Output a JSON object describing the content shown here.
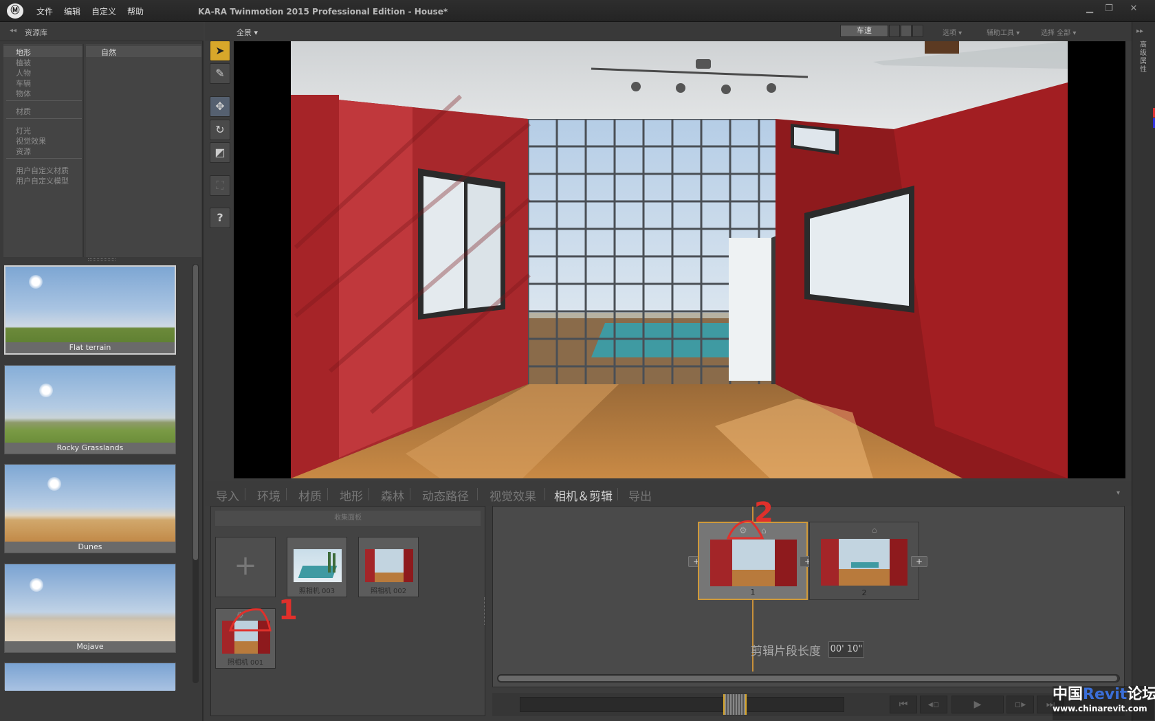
{
  "app": {
    "title": "KA-RA Twinmotion 2015 Professional Edition - House*",
    "logo": "Ⓜ",
    "menu": [
      "文件",
      "编辑",
      "自定义",
      "帮助"
    ]
  },
  "library": {
    "header": "资源库",
    "categories": [
      "地形",
      "植被",
      "人物",
      "车辆",
      "物体",
      "材质",
      "灯光",
      "视觉效果",
      "资源",
      "用户自定义材质",
      "用户自定义模型"
    ],
    "selected_category": "地形",
    "subcategory": "自然",
    "thumbnails": [
      {
        "label": "Flat terrain"
      },
      {
        "label": "Rocky Grasslands"
      },
      {
        "label": "Dunes"
      },
      {
        "label": "Mojave"
      }
    ]
  },
  "viewport_toolbar": {
    "view_dropdown": "全景 ▾",
    "speed_label": "车速",
    "options_menu": "选项 ▾",
    "assist_menu": "辅助工具 ▾",
    "select_menu": "选择 全部 ▾"
  },
  "right_strip": {
    "label": "高级属性"
  },
  "tools": {
    "help_label": "?"
  },
  "tabs": [
    "导入",
    "环境",
    "材质",
    "地形",
    "森林",
    "动态路径",
    "视觉效果",
    "相机＆剪辑",
    "导出"
  ],
  "active_tab": "相机＆剪辑",
  "collection": {
    "header": "收集面板",
    "add_label": "+",
    "cameras": [
      "照相机 003",
      "照相机 002",
      "照相机 001"
    ]
  },
  "clips": {
    "items": [
      {
        "label": "1"
      },
      {
        "label": "2"
      }
    ],
    "plus": "+",
    "duration_label": "剪辑片段长度",
    "duration_value": "00' 10\""
  },
  "annotations": {
    "mark1": "1",
    "mark2": "2"
  },
  "watermark": {
    "line1_a": "中国",
    "line1_b": "Revit",
    "line1_c": "论坛",
    "line2": "www.chinarevit.com"
  },
  "colors": {
    "accent": "#d8a72a",
    "wall": "#9b1f22",
    "floor": "#b87a3c",
    "annotation": "#e0302b"
  }
}
